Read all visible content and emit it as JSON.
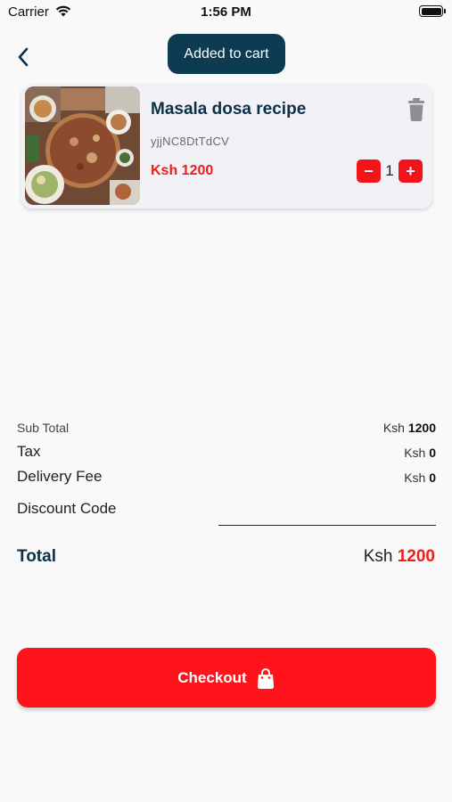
{
  "status_bar": {
    "carrier": "Carrier",
    "time": "1:56 PM"
  },
  "toast": {
    "text": "Added to cart"
  },
  "cart_item": {
    "title": "Masala dosa recipe",
    "code": "yjjNC8DtTdCV",
    "price": "Ksh 1200",
    "quantity": "1",
    "minus_label": "−",
    "plus_label": "+"
  },
  "summary": {
    "sub_total_label": "Sub Total",
    "sub_total_currency": "Ksh",
    "sub_total_amount": "1200",
    "tax_label": "Tax",
    "tax_currency": "Ksh",
    "tax_amount": "0",
    "delivery_label": "Delivery Fee",
    "delivery_currency": "Ksh",
    "delivery_amount": "0",
    "discount_label": "Discount Code",
    "discount_value": "",
    "total_label": "Total",
    "total_currency": "Ksh",
    "total_amount": "1200"
  },
  "checkout": {
    "label": "Checkout"
  },
  "icons": {
    "back": "chevron-left-icon",
    "trash": "trash-icon",
    "bag": "shopping-bag-icon",
    "wifi": "wifi-icon",
    "battery": "battery-icon"
  },
  "colors": {
    "primary_red": "#ff141c",
    "navy": "#0d3049",
    "toast_bg": "#0d3b52",
    "card_bg": "#f1f1f6"
  }
}
